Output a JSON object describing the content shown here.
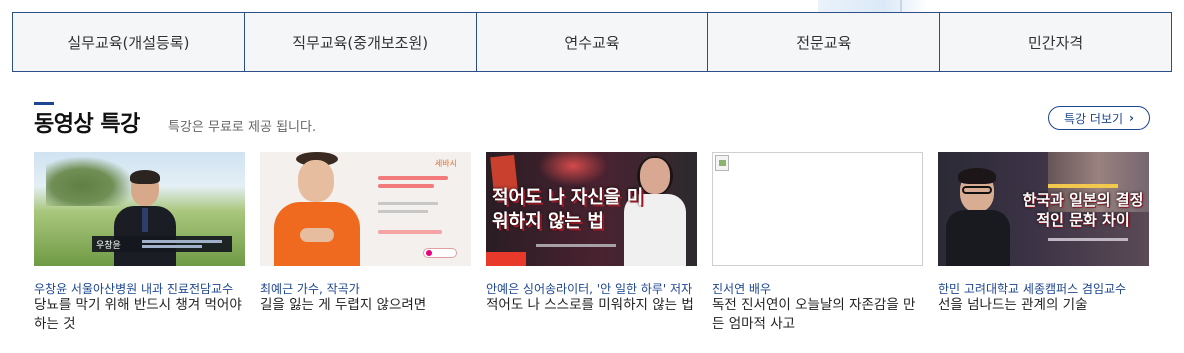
{
  "tabs": [
    {
      "label": "실무교육(개설등록)"
    },
    {
      "label": "직무교육(중개보조원)"
    },
    {
      "label": "연수교육"
    },
    {
      "label": "전문교육"
    },
    {
      "label": "민간자격"
    }
  ],
  "section": {
    "title": "동영상 특강",
    "subtitle": "특강은 무료로 제공 됩니다.",
    "more_label": "특강 더보기"
  },
  "cards": [
    {
      "sub": "우창윤 서울아산병원 내과 진료전담교수",
      "title": "당뇨를 막기 위해 반드시 챙겨 먹어야 하는 것",
      "thumb_caption_name": "우창윤"
    },
    {
      "sub": "최예근 가수, 작곡가",
      "title": "길을 잃는 게 두렵지 않으려면",
      "thumb_brand": "세바시"
    },
    {
      "sub": "안예은 싱어송라이터, '안 일한 하루' 저자",
      "title": "적어도 나 스스로를 미워하지 않는 법",
      "thumb_headline": "적어도 나 자신을 미워하지 않는 법"
    },
    {
      "sub": "진서연 배우",
      "title": "독전 진서연이 오늘날의 자존감을 만든 엄마적 사고"
    },
    {
      "sub": "한민 고려대학교 세종캠퍼스 겸임교수",
      "title": "선을 넘나드는 관계의 기술",
      "thumb_headline": "한국과 일본의 결정적인 문화 차이"
    }
  ],
  "colors": {
    "accent": "#1d4591",
    "tab_border": "#2b4f86",
    "tab_bg": "#f5f6f8"
  }
}
